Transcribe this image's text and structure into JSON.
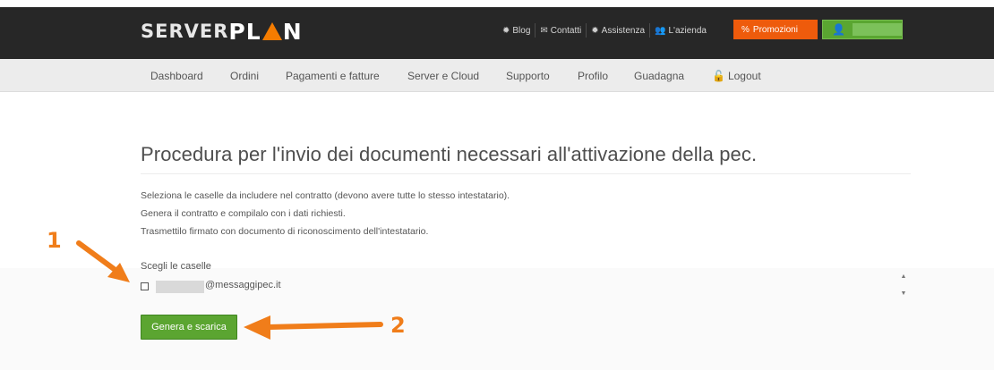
{
  "header": {
    "logo_part1": "SERVER",
    "logo_part2a": "PL",
    "logo_part2b": "N",
    "links": [
      {
        "label": "Blog",
        "icon": "gear-icon"
      },
      {
        "label": "Contatti",
        "icon": "envelope-icon"
      },
      {
        "label": "Assistenza",
        "icon": "gear-icon"
      },
      {
        "label": "L'azienda",
        "icon": "people-icon"
      }
    ],
    "promo_label": "Promozioni",
    "accent": "#ee5b0c",
    "user_color": "#5aa631"
  },
  "nav": {
    "items": [
      "Dashboard",
      "Ordini",
      "Pagamenti e fatture",
      "Server e Cloud",
      "Supporto",
      "Profilo",
      "Guadagna"
    ],
    "logout": "Logout"
  },
  "main": {
    "title": "Procedura per l'invio dei documenti necessari all'attivazione della pec.",
    "instructions": [
      "Seleziona le caselle da includere nel contratto (devono avere tutte lo stesso intestatario).",
      "Genera il contratto e compilalo con i dati richiesti.",
      "Trasmettilo firmato con documento di riconoscimento dell'intestatario."
    ],
    "choose_label": "Scegli le caselle",
    "mailbox_email": "@messaggipec.it",
    "button_label": "Genera e scarica",
    "button_color": "#5ba531"
  },
  "annotations": {
    "step1": "1",
    "step2": "2",
    "arrow_color": "#f07d1a"
  }
}
